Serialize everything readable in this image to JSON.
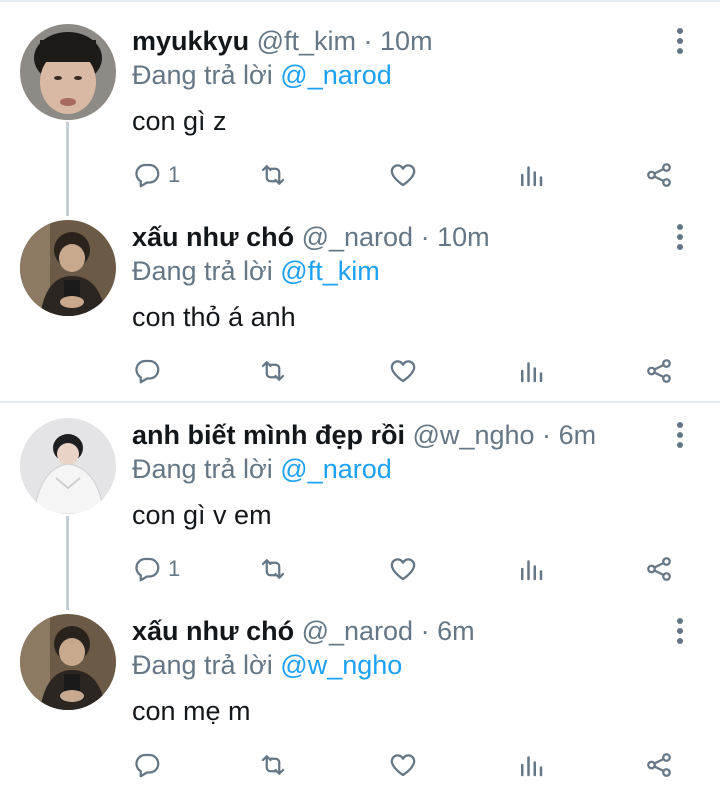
{
  "tweets": [
    {
      "name": "myukkyu",
      "handle": "@ft_kim",
      "time": "10m",
      "reply_prefix": "Đang trả lời",
      "reply_to": "@_narod",
      "text": "con gì z",
      "reply_count": "1"
    },
    {
      "name": "xấu như chó",
      "handle": "@_narod",
      "time": "10m",
      "reply_prefix": "Đang trả lời",
      "reply_to": "@ft_kim",
      "text": "con thỏ á anh",
      "reply_count": ""
    },
    {
      "name": "anh biết mình đẹp rồi",
      "handle": "@w_ngho",
      "time": "6m",
      "reply_prefix": "Đang trả lời",
      "reply_to": "@_narod",
      "text": "con gì v em",
      "reply_count": "1"
    },
    {
      "name": "xấu như chó",
      "handle": "@_narod",
      "time": "6m",
      "reply_prefix": "Đang trả lời",
      "reply_to": "@w_ngho",
      "text": "con mẹ m",
      "reply_count": ""
    }
  ],
  "separator": "·",
  "icons": [
    "reply-icon",
    "retweet-icon",
    "like-icon",
    "analytics-icon",
    "share-icon",
    "more-options-icon"
  ],
  "colors": {
    "mention": "#1da1f2",
    "muted": "#657786",
    "text": "#14171a"
  }
}
